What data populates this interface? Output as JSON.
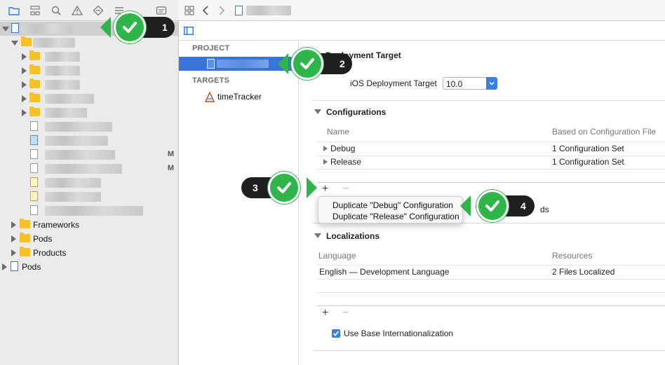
{
  "navigator": {
    "tree": [
      {
        "kind": "folder",
        "label": "Frameworks"
      },
      {
        "kind": "folder",
        "label": "Pods"
      },
      {
        "kind": "folder",
        "label": "Products"
      },
      {
        "kind": "project",
        "label": "Pods"
      }
    ],
    "modified_badges": [
      "M",
      "M"
    ]
  },
  "project_list": {
    "project_header": "PROJECT",
    "targets_header": "TARGETS",
    "target_name": "timeTracker"
  },
  "settings": {
    "deployment": {
      "title": "Deployment Target",
      "label": "iOS Deployment Target",
      "value": "10.0"
    },
    "configurations": {
      "title": "Configurations",
      "col_name": "Name",
      "col_based_on": "Based on Configuration File",
      "rows": [
        {
          "name": "Debug",
          "based_on": "1 Configuration Set"
        },
        {
          "name": "Release",
          "based_on": "1 Configuration Set"
        }
      ],
      "plus": "+",
      "minus": "−",
      "partial_text": "ds"
    },
    "localizations": {
      "title": "Localizations",
      "col_language": "Language",
      "col_resources": "Resources",
      "rows": [
        {
          "language": "English — Development Language",
          "resources": "2 Files Localized"
        }
      ],
      "plus": "+",
      "minus": "−",
      "base_intl_label": "Use Base Internationalization"
    }
  },
  "menu": {
    "items": [
      "Duplicate \"Debug\" Configuration",
      "Duplicate \"Release\" Configuration"
    ]
  },
  "callouts": [
    "1",
    "2",
    "3",
    "4"
  ],
  "colors": {
    "selection": "#3875d7",
    "callout_green": "#2fb54a",
    "callout_dark": "#1f1f1f",
    "folder": "#f5c127",
    "accent": "#3a7fe0"
  },
  "icons": [
    "folder-icon",
    "hierarchy-icon",
    "search-icon",
    "warning-icon",
    "diamond-icon",
    "list-icon",
    "message-icon",
    "grid-icon",
    "back-icon",
    "forward-icon",
    "file-icon",
    "sidebar-toggle-icon",
    "target-icon",
    "checkmark-icon"
  ]
}
